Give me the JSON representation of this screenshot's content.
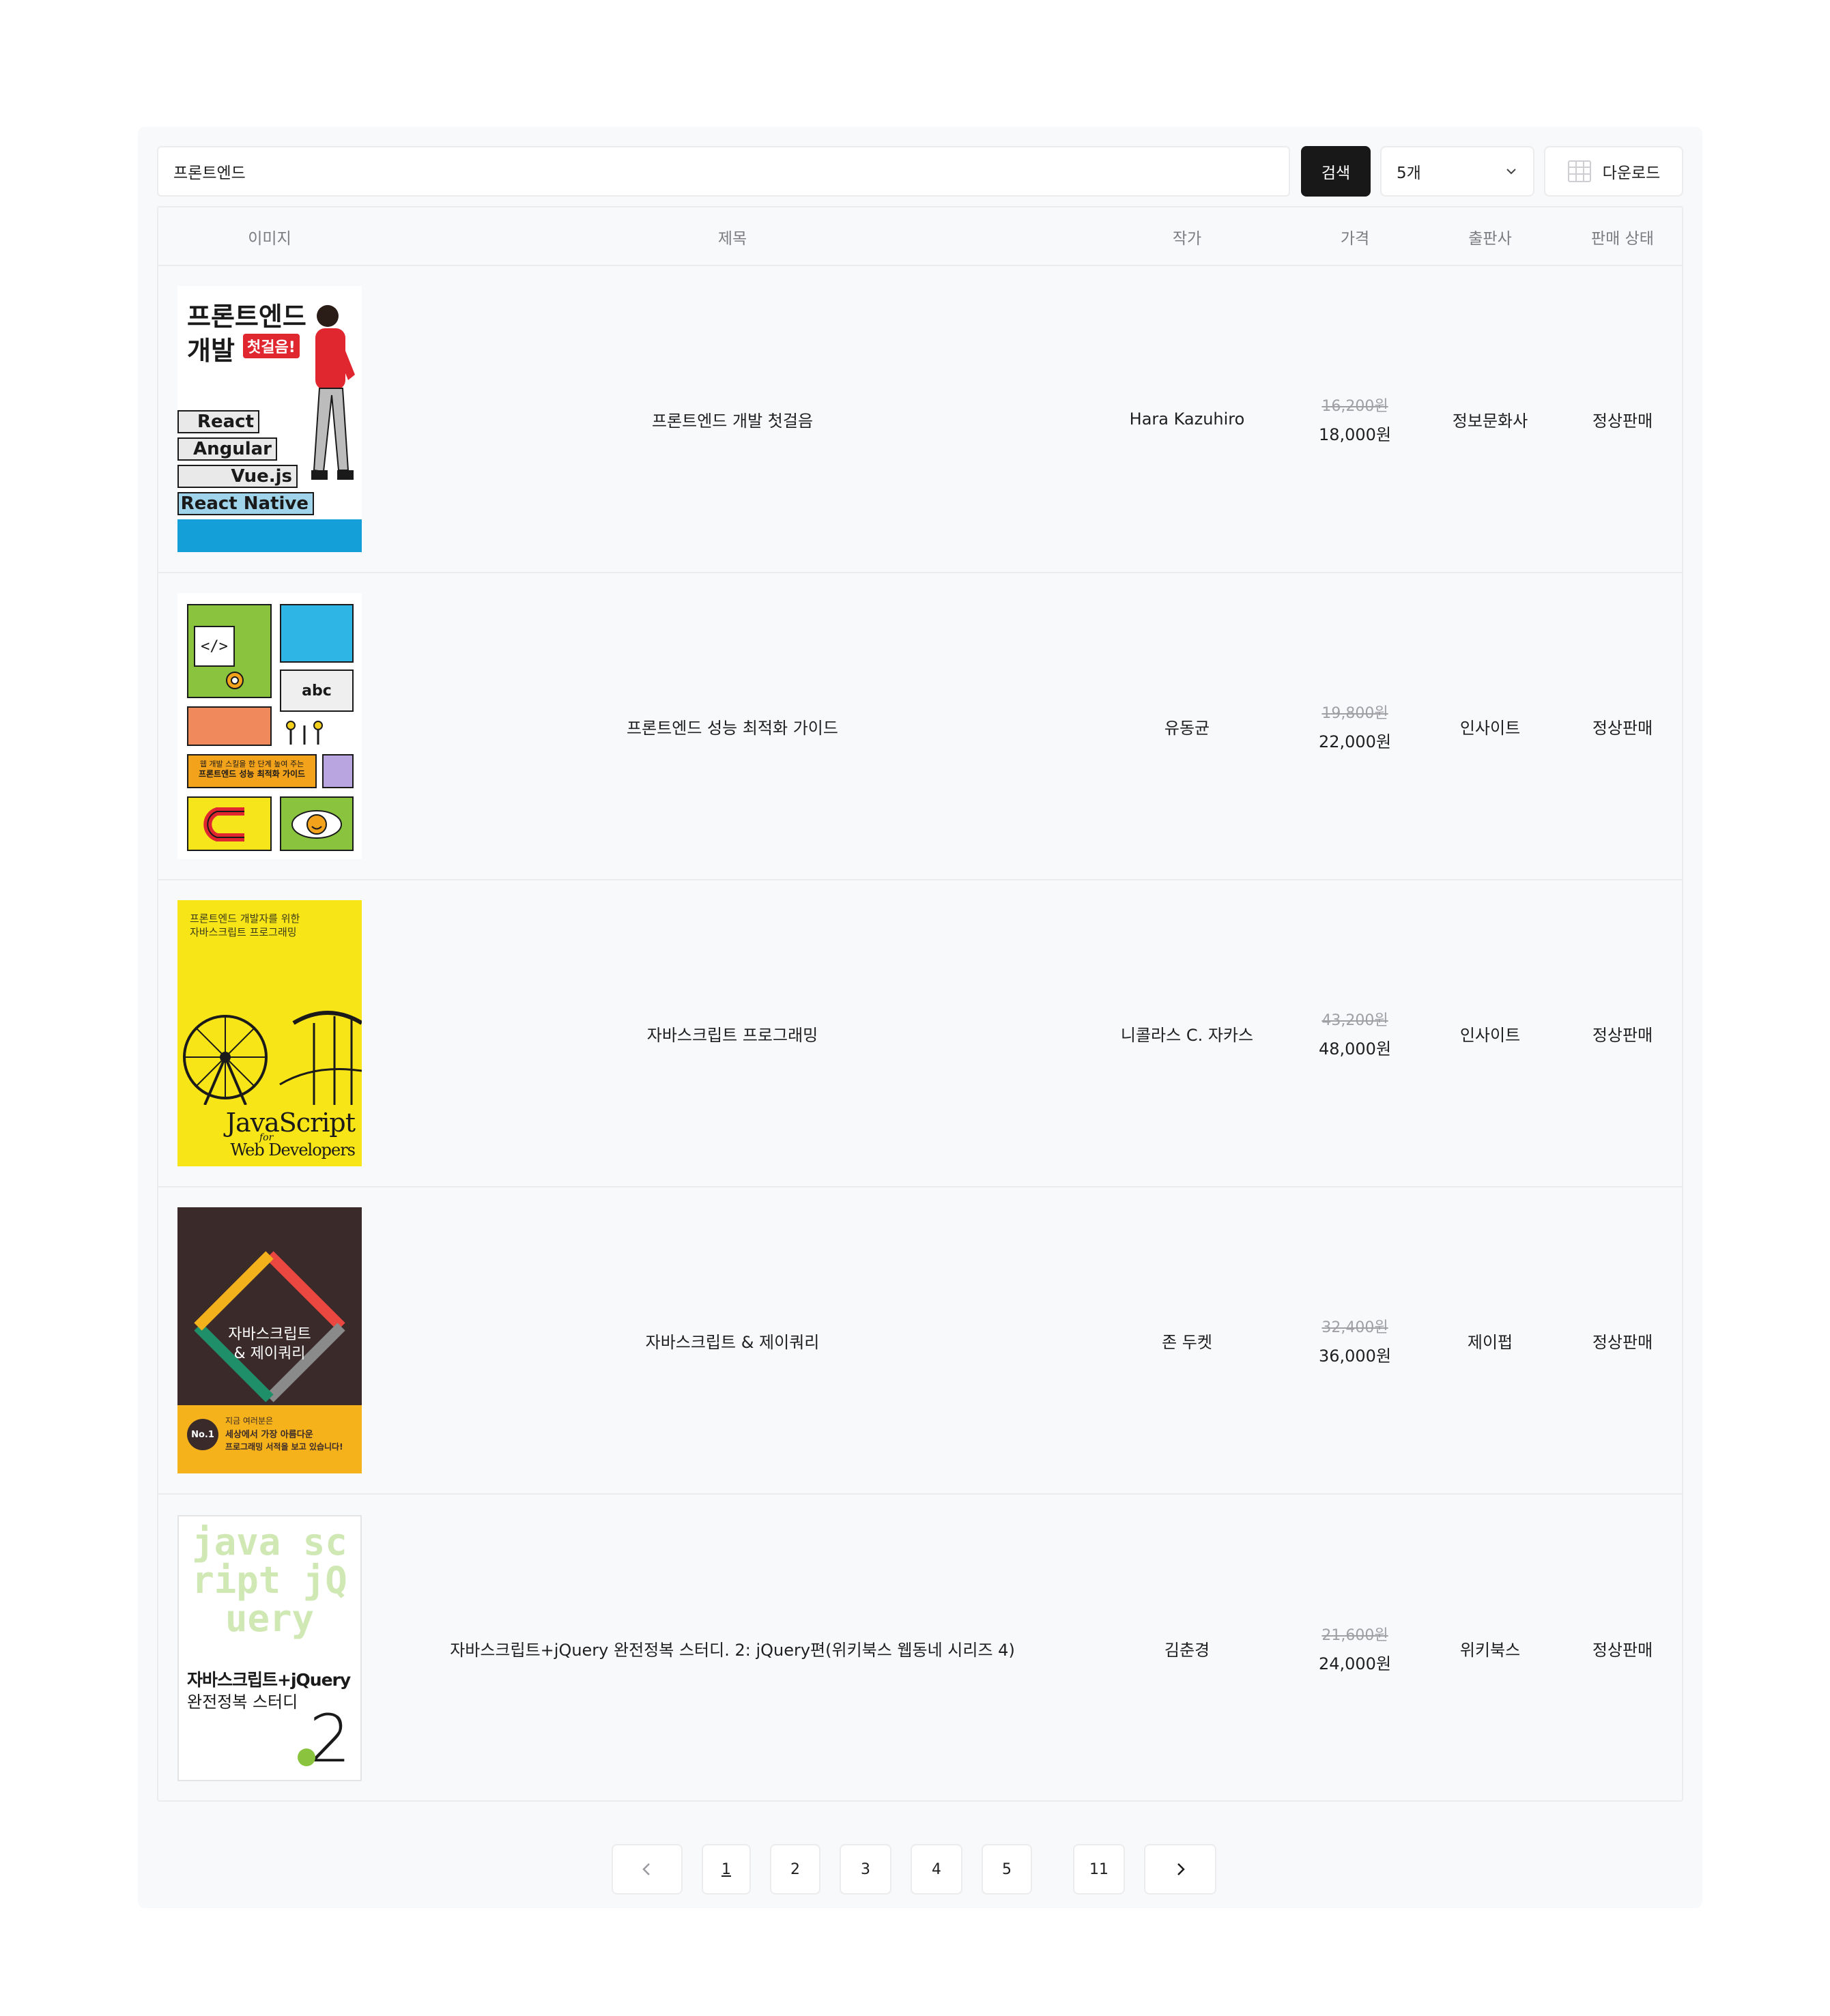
{
  "toolbar": {
    "search_value": "프론트엔드",
    "search_button": "검색",
    "page_size": "5개",
    "download_button": "다운로드"
  },
  "table": {
    "headers": [
      "이미지",
      "제목",
      "작가",
      "가격",
      "출판사",
      "판매 상태"
    ],
    "rows": [
      {
        "title": "프론트엔드 개발 첫걸음",
        "author": "Hara Kazuhiro",
        "old_price": "16,200원",
        "price": "18,000원",
        "publisher": "정보문화사",
        "status": "정상판매",
        "cover": {
          "line1": "프론트엔드",
          "line2": "개발",
          "badge": "첫걸음!",
          "items": [
            "React",
            "Angular",
            "Vue.js",
            "React Native"
          ]
        }
      },
      {
        "title": "프론트엔드 성능 최적화 가이드",
        "author": "유동균",
        "old_price": "19,800원",
        "price": "22,000원",
        "publisher": "인사이트",
        "status": "정상판매",
        "cover": {
          "code": "</>",
          "abc": "abc",
          "band1": "웹 개발 스킬을 한 단계 높여 주는",
          "band2": "프론트엔드 성능 최적화 가이드"
        }
      },
      {
        "title": "자바스크립트 프로그래밍",
        "author": "니콜라스 C. 자카스",
        "old_price": "43,200원",
        "price": "48,000원",
        "publisher": "인사이트",
        "status": "정상판매",
        "cover": {
          "top1": "프론트엔드 개발자를 위한",
          "top2": "자바스크립트 프로그래밍",
          "js": "JavaScript",
          "for": "for",
          "web": "Web Developers"
        }
      },
      {
        "title": "자바스크립트 & 제이쿼리",
        "author": "존 두켓",
        "old_price": "32,400원",
        "price": "36,000원",
        "publisher": "제이펍",
        "status": "정상판매",
        "cover": {
          "t1": "자바스크립트",
          "t2": "& 제이쿼리",
          "badge": "No.1",
          "y1": "지금 여러분은",
          "y2": "세상에서 가장 아름다운",
          "y3": "프로그래밍 서적을 보고 있습니다!"
        }
      },
      {
        "title": "자바스크립트+jQuery 완전정복 스터디. 2: jQuery편(위키북스 웹동네 시리즈 4)",
        "author": "김춘경",
        "old_price": "21,600원",
        "price": "24,000원",
        "publisher": "위키북스",
        "status": "정상판매",
        "cover": {
          "deco": "java script jQuery",
          "t1": "자바스크립트+jQuery",
          "t2": "완전정복 스터디",
          "num": "2"
        }
      }
    ]
  },
  "pagination": {
    "pages": [
      "1",
      "2",
      "3",
      "4",
      "5"
    ],
    "last": "11",
    "current": "1"
  }
}
